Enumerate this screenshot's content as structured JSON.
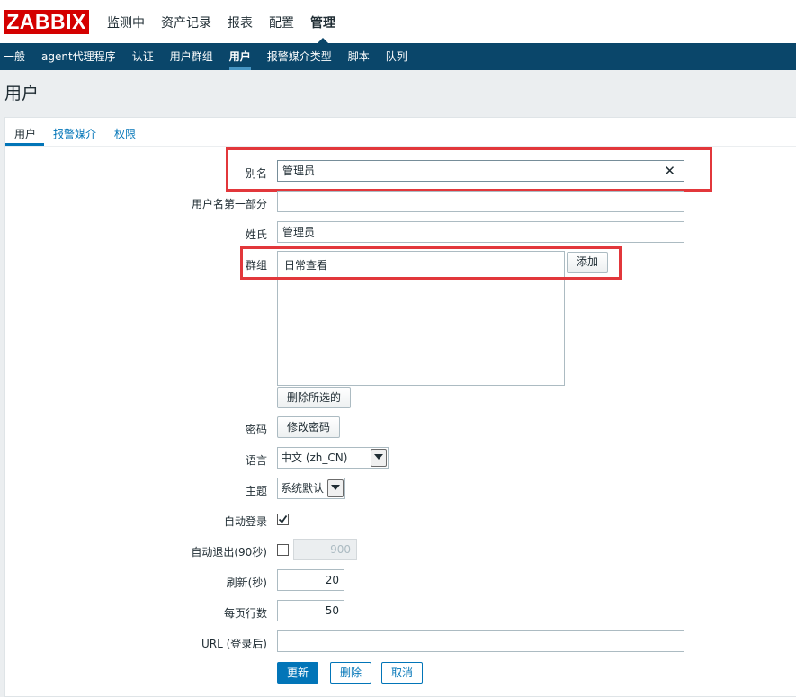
{
  "header": {
    "logo": "ZABBIX",
    "main_menu": [
      {
        "label": "监测中"
      },
      {
        "label": "资产记录"
      },
      {
        "label": "报表"
      },
      {
        "label": "配置"
      },
      {
        "label": "管理",
        "active": true
      }
    ]
  },
  "sub_menu": [
    {
      "label": "一般"
    },
    {
      "label": "agent代理程序"
    },
    {
      "label": "认证"
    },
    {
      "label": "用户群组"
    },
    {
      "label": "用户",
      "active": true
    },
    {
      "label": "报警媒介类型"
    },
    {
      "label": "脚本"
    },
    {
      "label": "队列"
    }
  ],
  "page": {
    "title": "用户"
  },
  "tabs": [
    {
      "label": "用户",
      "active": true
    },
    {
      "label": "报警媒介"
    },
    {
      "label": "权限"
    }
  ],
  "form": {
    "alias": {
      "label": "别名",
      "value": "管理员"
    },
    "first_name": {
      "label": "用户名第一部分",
      "value": ""
    },
    "surname": {
      "label": "姓氏",
      "value": "管理员"
    },
    "groups": {
      "label": "群组",
      "items": [
        "日常查看"
      ],
      "add_label": "添加",
      "remove_label": "删除所选的"
    },
    "password": {
      "label": "密码",
      "button": "修改密码"
    },
    "language": {
      "label": "语言",
      "value": "中文 (zh_CN)"
    },
    "theme": {
      "label": "主题",
      "value": "系统默认"
    },
    "autologin": {
      "label": "自动登录",
      "checked": true
    },
    "autologout": {
      "label": "自动退出(90秒)",
      "checked": false,
      "value": "900"
    },
    "refresh": {
      "label": "刷新(秒)",
      "value": "20"
    },
    "rows_per_page": {
      "label": "每页行数",
      "value": "50"
    },
    "url": {
      "label": "URL (登录后)",
      "value": ""
    },
    "buttons": {
      "update": "更新",
      "delete": "删除",
      "cancel": "取消"
    }
  },
  "colors": {
    "brand_red": "#d40000",
    "nav_dark": "#0a466a",
    "accent_blue": "#0275b8",
    "highlight_red": "#e2373b"
  }
}
